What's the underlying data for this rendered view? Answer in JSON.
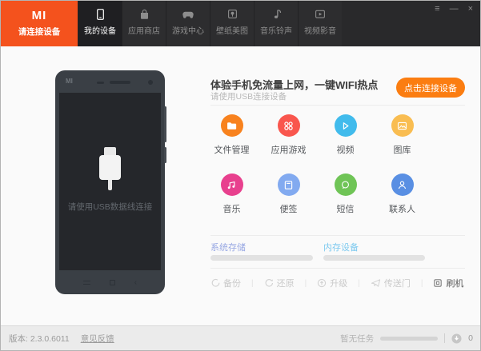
{
  "window": {
    "controls": {
      "menu": "≡",
      "minimize": "—",
      "close": "×"
    }
  },
  "colors": {
    "brand_orange": "#f4521d",
    "button_orange": "#fb7d11"
  },
  "topbar": {
    "logo": "MI",
    "status": "请连接设备",
    "tabs": [
      {
        "label": "我的设备",
        "icon": "my-device-icon",
        "active": true
      },
      {
        "label": "应用商店",
        "icon": "app-store-icon",
        "active": false
      },
      {
        "label": "游戏中心",
        "icon": "game-center-icon",
        "active": false
      },
      {
        "label": "壁纸美图",
        "icon": "wallpaper-icon",
        "active": false
      },
      {
        "label": "音乐铃声",
        "icon": "music-ringtone-icon",
        "active": false
      },
      {
        "label": "视频影音",
        "icon": "video-media-icon",
        "active": false
      }
    ]
  },
  "phone": {
    "logo": "MI",
    "screen_message": "请使用USB数据线连接"
  },
  "connect": {
    "title": "体验手机免流量上网，一键WIFI热点",
    "subtitle": "请使用USB连接设备",
    "button_label": "点击连接设备"
  },
  "shortcuts": [
    {
      "label": "文件管理",
      "icon": "folder-icon",
      "color": "#f8821e"
    },
    {
      "label": "应用游戏",
      "icon": "apps-games-icon",
      "color": "#f9564d"
    },
    {
      "label": "视频",
      "icon": "play-icon",
      "color": "#41bbec"
    },
    {
      "label": "图库",
      "icon": "gallery-icon",
      "color": "#f9bd51"
    },
    {
      "label": "音乐",
      "icon": "music-note-icon",
      "color": "#e8408e"
    },
    {
      "label": "便签",
      "icon": "notes-icon",
      "color": "#82aaf0"
    },
    {
      "label": "短信",
      "icon": "sms-bubble-icon",
      "color": "#6fc456"
    },
    {
      "label": "联系人",
      "icon": "contact-icon",
      "color": "#598fe3"
    }
  ],
  "storage": [
    {
      "label": "系统存储",
      "color": "#97a7e3",
      "progress": 0
    },
    {
      "label": "内存设备",
      "color": "#7cc9ef",
      "progress": 0
    }
  ],
  "tools": {
    "separator": "|",
    "items": [
      {
        "label": "备份",
        "icon": "backup-icon",
        "enabled": false
      },
      {
        "label": "还原",
        "icon": "restore-icon",
        "enabled": false
      },
      {
        "label": "升级",
        "icon": "upgrade-icon",
        "enabled": false
      },
      {
        "label": "传送门",
        "icon": "portal-icon",
        "enabled": false
      },
      {
        "label": "刷机",
        "icon": "flash-rom-icon",
        "enabled": true
      }
    ]
  },
  "statusbar": {
    "version_label": "版本: 2.3.0.6011",
    "feedback_link": "意见反馈",
    "task_status": "暂无任务",
    "download_count": "0"
  }
}
